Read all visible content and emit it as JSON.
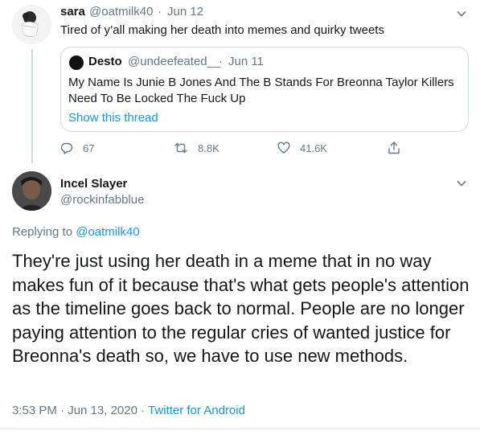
{
  "tweet1": {
    "name": "sara",
    "handle": "@oatmilk40",
    "sep": "·",
    "date": "Jun 12",
    "text": "Tired of y’all making her death into memes and quirky tweets",
    "quote": {
      "name": "Desto",
      "handle": "@undeefeated__",
      "sep": "·",
      "date": "Jun 11",
      "line1": "My Name Is Junie B Jones And The B Stands For Breonna Taylor Killers",
      "line2": "Need To Be Locked The Fuck Up",
      "show_thread": "Show this thread"
    },
    "actions": {
      "replies": "67",
      "retweets": "8.8K",
      "likes": "41.6K"
    }
  },
  "tweet2": {
    "name": "Incel Slayer",
    "handle": "@rockinfabblue",
    "replying_prefix": "Replying to",
    "replying_to": "@oatmilk40",
    "text": "They're just using her death in a meme that in no way makes fun of it because that's what gets people's attention as the timeline goes back to normal. People are no longer paying attention to the regular cries of wanted justice for Breonna's death so, we have to use new methods.",
    "time": "3:53 PM",
    "sep1": "·",
    "date": "Jun 13, 2020",
    "sep2": "·",
    "source": "Twitter for Android"
  },
  "icons": [
    "chevron-down-icon",
    "reply-icon",
    "retweet-icon",
    "like-icon",
    "share-icon"
  ],
  "colors": {
    "link": "#1b95e0",
    "muted": "#657786",
    "text": "#14171a",
    "border": "#cfd9de"
  }
}
